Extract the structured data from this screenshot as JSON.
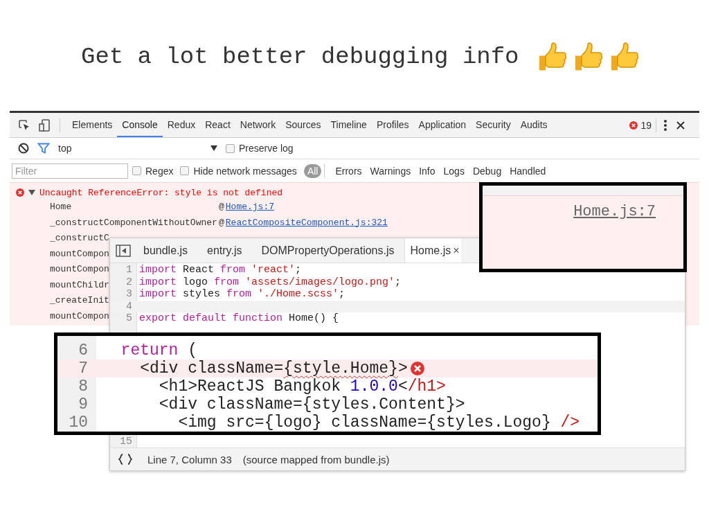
{
  "slide_title": "Get a lot better debugging info",
  "devtools": {
    "tabs": [
      {
        "label": "Elements",
        "selected": false
      },
      {
        "label": "Console",
        "selected": true
      },
      {
        "label": "Redux",
        "selected": false
      },
      {
        "label": "React",
        "selected": false
      },
      {
        "label": "Network",
        "selected": false
      },
      {
        "label": "Sources",
        "selected": false
      },
      {
        "label": "Timeline",
        "selected": false
      },
      {
        "label": "Profiles",
        "selected": false
      },
      {
        "label": "Application",
        "selected": false
      },
      {
        "label": "Security",
        "selected": false
      },
      {
        "label": "Audits",
        "selected": false
      }
    ],
    "error_count": "19",
    "context": "top",
    "preserve_log": {
      "label": "Preserve log",
      "checked": false
    },
    "filter": {
      "placeholder": "Filter"
    },
    "options": [
      {
        "label": "Regex",
        "checked": false
      },
      {
        "label": "Hide network messages",
        "checked": false
      }
    ],
    "levels": [
      {
        "label": "All",
        "selected": true
      },
      {
        "label": "Errors",
        "selected": false
      },
      {
        "label": "Warnings",
        "selected": false
      },
      {
        "label": "Info",
        "selected": false
      },
      {
        "label": "Logs",
        "selected": false
      },
      {
        "label": "Debug",
        "selected": false
      },
      {
        "label": "Handled",
        "selected": false
      }
    ]
  },
  "console": {
    "error": {
      "message": "Uncaught ReferenceError: style is not defined",
      "expanded": true
    },
    "frames": [
      {
        "function": "Home",
        "at": "@",
        "source": "Home.js:7"
      },
      {
        "function": "_constructComponentWithoutOwner",
        "at": "@",
        "source": "ReactCompositeComponent.js:321"
      },
      {
        "function": "_constructC"
      },
      {
        "function": "mountCompon"
      },
      {
        "function": "mountCompon"
      },
      {
        "function": "mountChildr"
      },
      {
        "function": "_createInit"
      },
      {
        "function": "mountCompon"
      }
    ]
  },
  "editor": {
    "tabs": [
      {
        "label": "bundle.js",
        "selected": false
      },
      {
        "label": "entry.js",
        "selected": false
      },
      {
        "label": "DOMPropertyOperations.js",
        "selected": false
      },
      {
        "label": "Home.js",
        "selected": true,
        "close": "×"
      }
    ],
    "lines": [
      {
        "number": "1",
        "highlighted": false,
        "tokens": [
          {
            "kind": "keyword",
            "text": "import"
          },
          {
            "kind": "plain",
            "text": " React "
          },
          {
            "kind": "keyword",
            "text": "from"
          },
          {
            "kind": "string",
            "text": " 'react'"
          },
          {
            "kind": "plain",
            "text": ";"
          }
        ]
      },
      {
        "number": "2",
        "highlighted": false,
        "tokens": [
          {
            "kind": "keyword",
            "text": "import"
          },
          {
            "kind": "plain",
            "text": " logo "
          },
          {
            "kind": "keyword",
            "text": "from"
          },
          {
            "kind": "string",
            "text": " 'assets/images/logo.png'"
          },
          {
            "kind": "plain",
            "text": ";"
          }
        ]
      },
      {
        "number": "3",
        "highlighted": false,
        "tokens": [
          {
            "kind": "keyword",
            "text": "import"
          },
          {
            "kind": "plain",
            "text": " styles "
          },
          {
            "kind": "keyword",
            "text": "from"
          },
          {
            "kind": "string",
            "text": " './Home.scss'"
          },
          {
            "kind": "plain",
            "text": ";"
          }
        ]
      },
      {
        "number": "4",
        "highlighted": true
      },
      {
        "number": "5",
        "highlighted": false,
        "tokens": [
          {
            "kind": "keyword",
            "text": "export default function"
          },
          {
            "kind": "plain",
            "text": " Home() {"
          }
        ]
      },
      {
        "number": "15",
        "highlighted": false
      }
    ],
    "status": {
      "position": "Line 7, Column 33",
      "mapping": "(source mapped from bundle.js)"
    }
  },
  "code_zoom": {
    "lines": [
      {
        "number": "6",
        "error": false,
        "tokens": [
          {
            "kind": "keyword",
            "text": "  return"
          },
          {
            "kind": "plain",
            "text": " ("
          }
        ]
      },
      {
        "number": "7",
        "error": true,
        "tokens": [
          {
            "kind": "plain",
            "text": "    <div className="
          },
          {
            "kind": "plain",
            "text": "{style.Home}",
            "squiggle": true
          },
          {
            "kind": "plain",
            "text": ">"
          }
        ]
      },
      {
        "number": "8",
        "error": false,
        "tokens": [
          {
            "kind": "plain",
            "text": "      <h1>ReactJS Bangkok "
          },
          {
            "kind": "number",
            "text": "1.0.0"
          },
          {
            "kind": "plain",
            "text": "<"
          },
          {
            "kind": "string",
            "text": "/h1>"
          }
        ]
      },
      {
        "number": "9",
        "error": false,
        "tokens": [
          {
            "kind": "plain",
            "text": "      <div className={styles.Content}>"
          }
        ]
      },
      {
        "number": "10",
        "error": false,
        "tokens": [
          {
            "kind": "plain",
            "text": "        <img src={logo} className={styles.Logo} "
          },
          {
            "kind": "string",
            "text": "/>"
          }
        ]
      }
    ]
  },
  "link_zoom": {
    "link": "Home.js:7"
  }
}
